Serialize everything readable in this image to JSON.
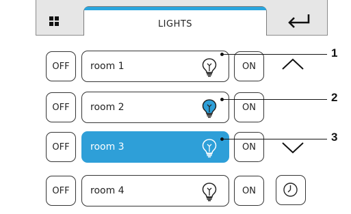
{
  "header": {
    "title": "LIGHTS",
    "menu_icon": "grid-icon",
    "back_icon": "return-icon",
    "accent_color": "#2aa5dd"
  },
  "rooms": [
    {
      "off_label": "OFF",
      "name": "room 1",
      "on_label": "ON",
      "bulb_state": "off",
      "selected": false
    },
    {
      "off_label": "OFF",
      "name": "room 2",
      "on_label": "ON",
      "bulb_state": "on",
      "selected": false
    },
    {
      "off_label": "OFF",
      "name": "room 3",
      "on_label": "ON",
      "bulb_state": "off",
      "selected": true
    },
    {
      "off_label": "OFF",
      "name": "room 4",
      "on_label": "ON",
      "bulb_state": "off",
      "selected": false
    }
  ],
  "side_controls": {
    "up_icon": "chevron-up-icon",
    "down_icon": "chevron-down-icon",
    "timer_icon": "clock-icon"
  },
  "callouts": [
    "1",
    "2",
    "3"
  ],
  "colors": {
    "selected_background": "#2e9fd8",
    "bulb_on_fill": "#2e9fd8"
  }
}
